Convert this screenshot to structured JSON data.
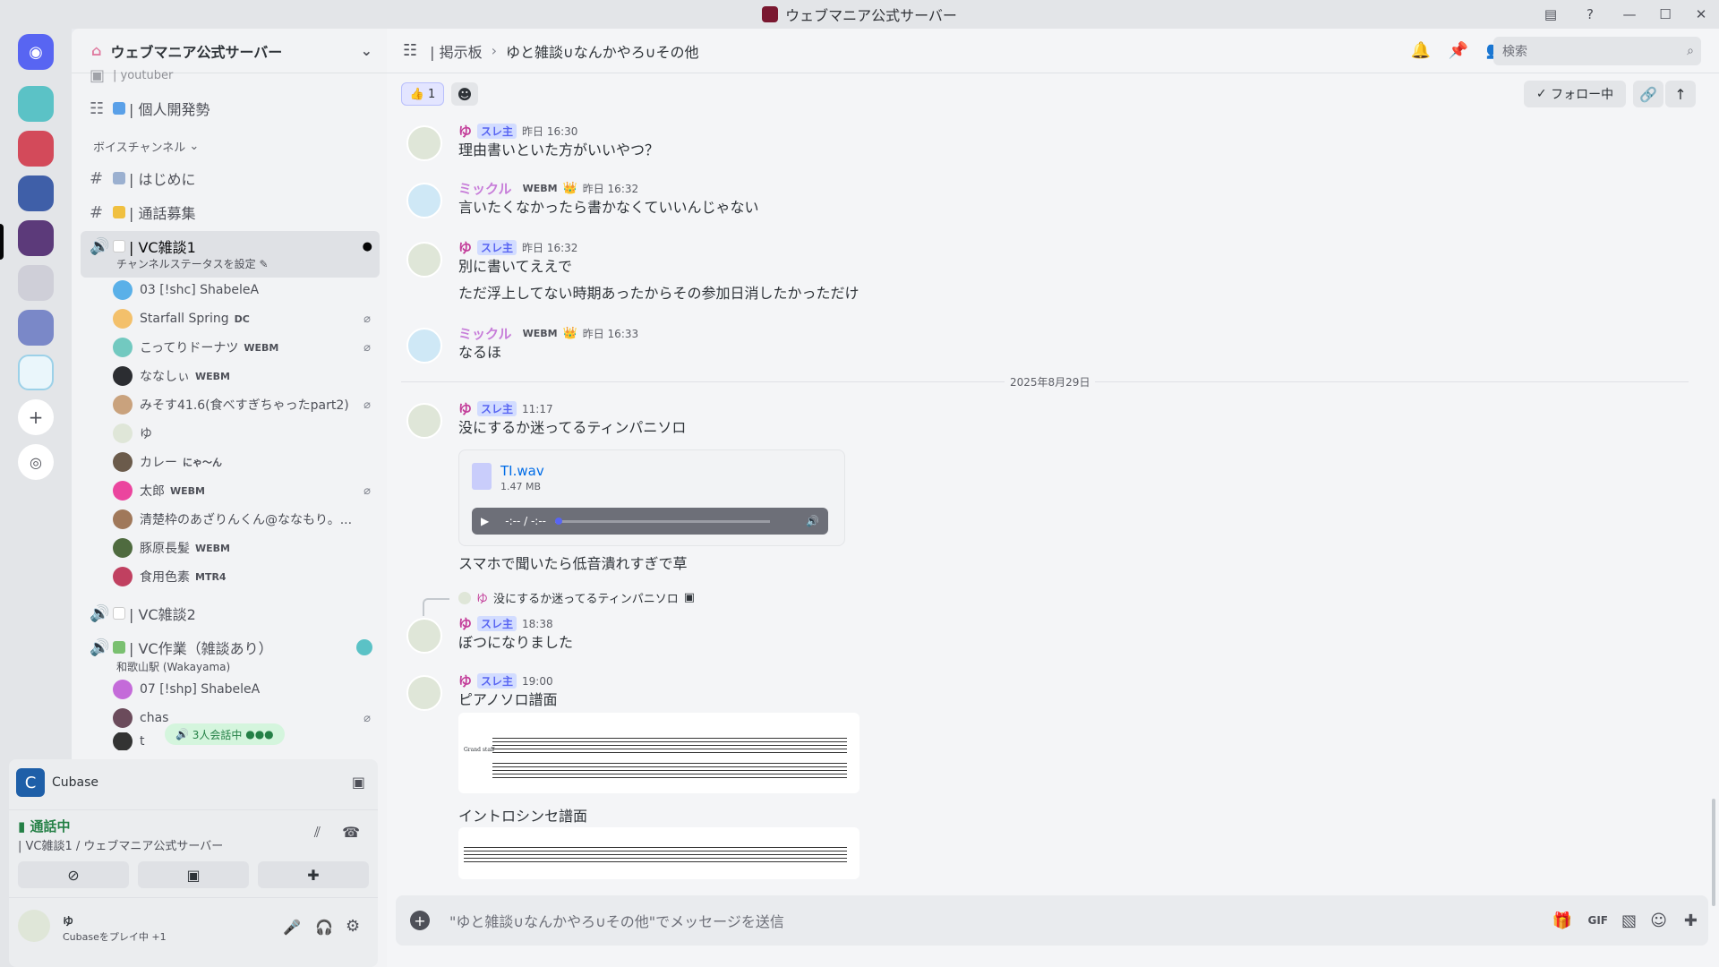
{
  "window": {
    "title": "ウェブマニア公式サーバー",
    "controls": [
      "inbox-icon",
      "help-icon",
      "minimize",
      "maximize",
      "close"
    ]
  },
  "server": {
    "name": "ウェブマニア公式サーバー"
  },
  "sidebar": {
    "partial_top": "| youtuber",
    "channels_top": [
      {
        "label": "| 個人開発勢"
      }
    ],
    "voice_category": "ボイスチャンネル",
    "text_channels": [
      {
        "label": "| はじめに"
      },
      {
        "label": "| 通話募集"
      }
    ],
    "vc1": {
      "label": "| VC雑談1",
      "status": "チャンネルステータスを設定"
    },
    "vc1_users": [
      {
        "name": "03 [!shc] ShabeleA",
        "tag": ""
      },
      {
        "name": "Starfall Spring",
        "tag": "DC"
      },
      {
        "name": "こってりドーナツ",
        "tag": "WEBM"
      },
      {
        "name": "ななしぃ",
        "tag": "WEBM"
      },
      {
        "name": "みそす41.6(食べすぎちゃったpart2)",
        "tag": ""
      },
      {
        "name": "ゆ",
        "tag": ""
      },
      {
        "name": "カレー",
        "tag": "にゃ～ん"
      },
      {
        "name": "太郎",
        "tag": "WEBM"
      },
      {
        "name": "清楚枠のあざりんくん@ななもり。...",
        "tag": ""
      },
      {
        "name": "豚原長髪",
        "tag": "WEBM"
      },
      {
        "name": "食用色素",
        "tag": "MTR4"
      }
    ],
    "vc2": {
      "label": "| VC雑談2"
    },
    "vc_work": {
      "label": "| VC作業（雑談あり）",
      "status": "和歌山駅 (Wakayama)"
    },
    "vc_work_users": [
      {
        "name": "07 [!shp] ShabeleA"
      },
      {
        "name": "chas"
      },
      {
        "name": "t"
      }
    ],
    "talking_pill": "3人会話中"
  },
  "activity": {
    "app": "Cubase"
  },
  "voice": {
    "status": "通話中",
    "channel": "| VC雑談1 / ウェブマニア公式サーバー"
  },
  "user": {
    "name": "ゆ",
    "activity": "Cubaseをプレイ中 +1"
  },
  "header": {
    "forum": "| 掲示板",
    "thread": "ゆと雑談∪なんかやろ∪その他",
    "search_placeholder": "検索"
  },
  "reactions": {
    "thumbs_count": "1"
  },
  "follow_label": "フォロー中",
  "messages": [
    {
      "author": "ゆ",
      "badge": "スレ主",
      "time": "昨日 16:30",
      "lines": [
        "理由書いといた方がいいやつ？"
      ]
    },
    {
      "author": "ミックル",
      "tag": "WEBM",
      "time": "昨日 16:32",
      "lines": [
        "言いたくなかったら書かなくていいんじゃない"
      ]
    },
    {
      "author": "ゆ",
      "badge": "スレ主",
      "time": "昨日 16:32",
      "lines": [
        "別に書いてええで",
        "ただ浮上してない時期あったからその参加日消したかっただけ"
      ]
    },
    {
      "author": "ミックル",
      "tag": "WEBM",
      "time": "昨日 16:33",
      "lines": [
        "なるほ"
      ]
    },
    {
      "author": "ゆ",
      "badge": "スレ主",
      "time": "11:17",
      "lines": [
        "没にするか迷ってるティンパニソロ"
      ]
    },
    {
      "author": "ゆ",
      "badge": "スレ主",
      "time": "18:38",
      "lines": [
        "ぼつになりました"
      ]
    },
    {
      "author": "ゆ",
      "badge": "スレ主",
      "time": "19:00",
      "lines": [
        "ピアノソロ譜面"
      ]
    }
  ],
  "date_divider": "2025年8月29日",
  "attachment": {
    "filename": "TI.wav",
    "size": "1.47 MB",
    "time": "-:-- / -:--"
  },
  "after_audio": "スマホで聞いたら低音潰れすぎで草",
  "reply_ref": {
    "author": "ゆ",
    "text": "没にするか迷ってるティンパニソロ"
  },
  "score_labels": {
    "staff_name": "Grand staff",
    "second_caption": "イントロシンセ譜面"
  },
  "composer_placeholder": "\"ゆと雑談∪なんかやろ∪その他\"でメッセージを送信",
  "colors": {
    "accent": "#5865f2",
    "author_yu": "#c33e9a",
    "author_mikkuru": "#c77dd9",
    "voice_green": "#248046"
  }
}
